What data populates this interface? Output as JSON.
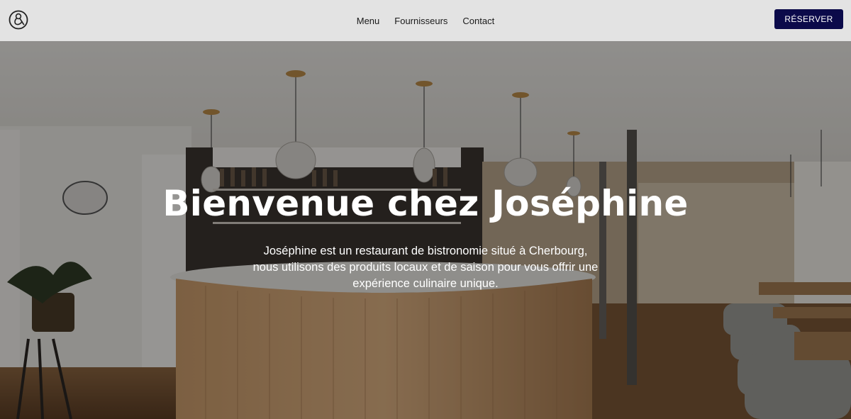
{
  "navbar": {
    "logo_icon": "restaurant-logo-icon",
    "links": [
      {
        "label": "Menu"
      },
      {
        "label": "Fournisseurs"
      },
      {
        "label": "Contact"
      }
    ],
    "reserve_label": "RÉSERVER",
    "accent_color": "#0b0a4a"
  },
  "hero": {
    "background": "restaurant-interior-photo",
    "title": "Bienvenue chez Joséphine",
    "description_lines": [
      "Joséphine est un restaurant de bistronomie situé à Cherbourg,",
      "nous utilisons des produits locaux et de saison pour vous offrir une",
      "expérience culinaire unique."
    ]
  }
}
